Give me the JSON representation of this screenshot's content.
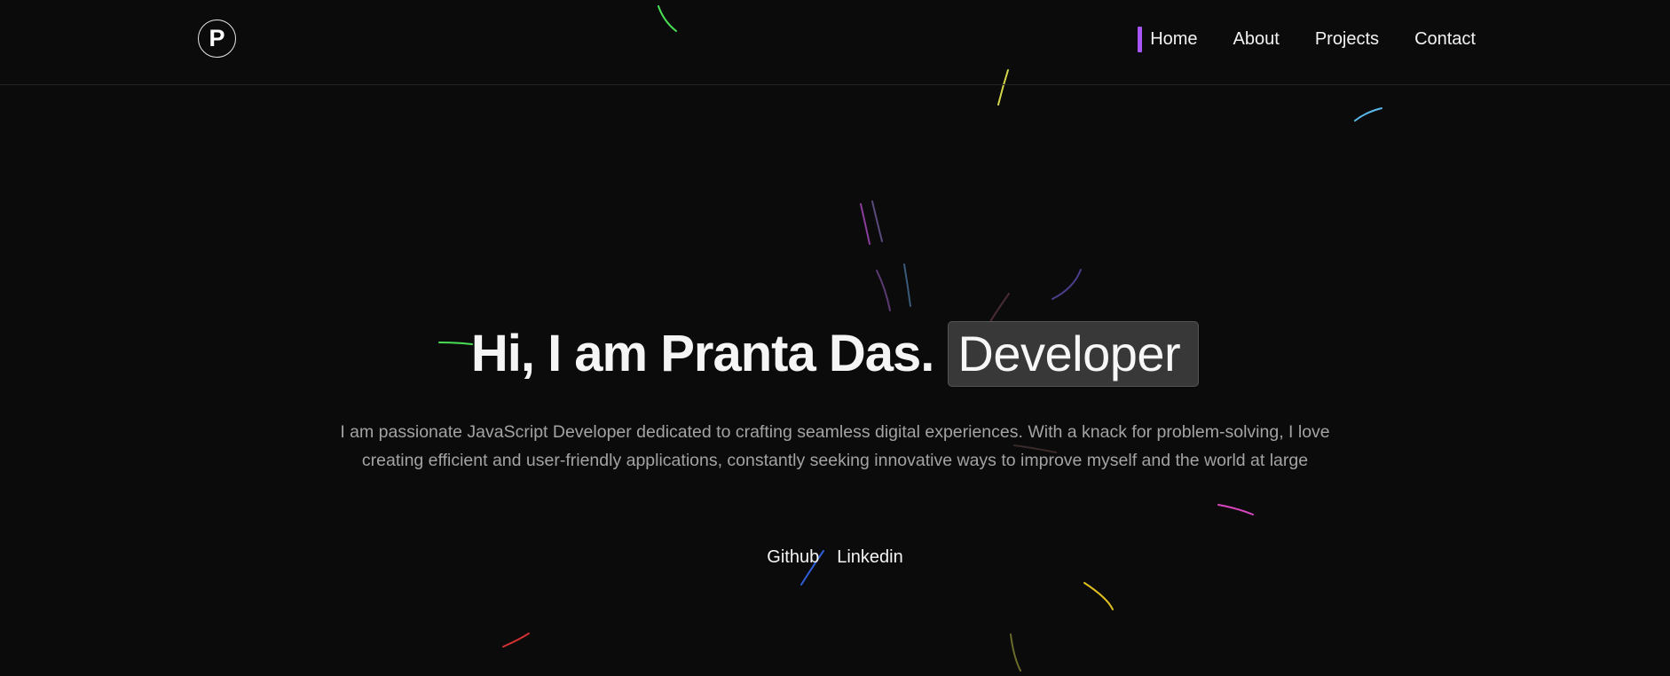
{
  "header": {
    "logo_letter": "P",
    "nav": [
      {
        "label": "Home",
        "active": true
      },
      {
        "label": "About",
        "active": false
      },
      {
        "label": "Projects",
        "active": false
      },
      {
        "label": "Contact",
        "active": false
      }
    ],
    "active_indicator_color": "#a855f7"
  },
  "hero": {
    "title": "Hi, I am Pranta Das.",
    "highlight": "Developer",
    "description": "I am passionate JavaScript Developer dedicated to crafting seamless digital experiences. With a knack for problem-solving, I love creating efficient and user-friendly applications, constantly seeking innovative ways to improve myself and the world at large",
    "links": [
      {
        "label": "Github"
      },
      {
        "label": "Linkedin"
      }
    ]
  },
  "colors": {
    "background": "#0b0b0c",
    "accent": "#a855f7",
    "highlight_bg": "#383838",
    "description_text": "#a3a3a3"
  }
}
